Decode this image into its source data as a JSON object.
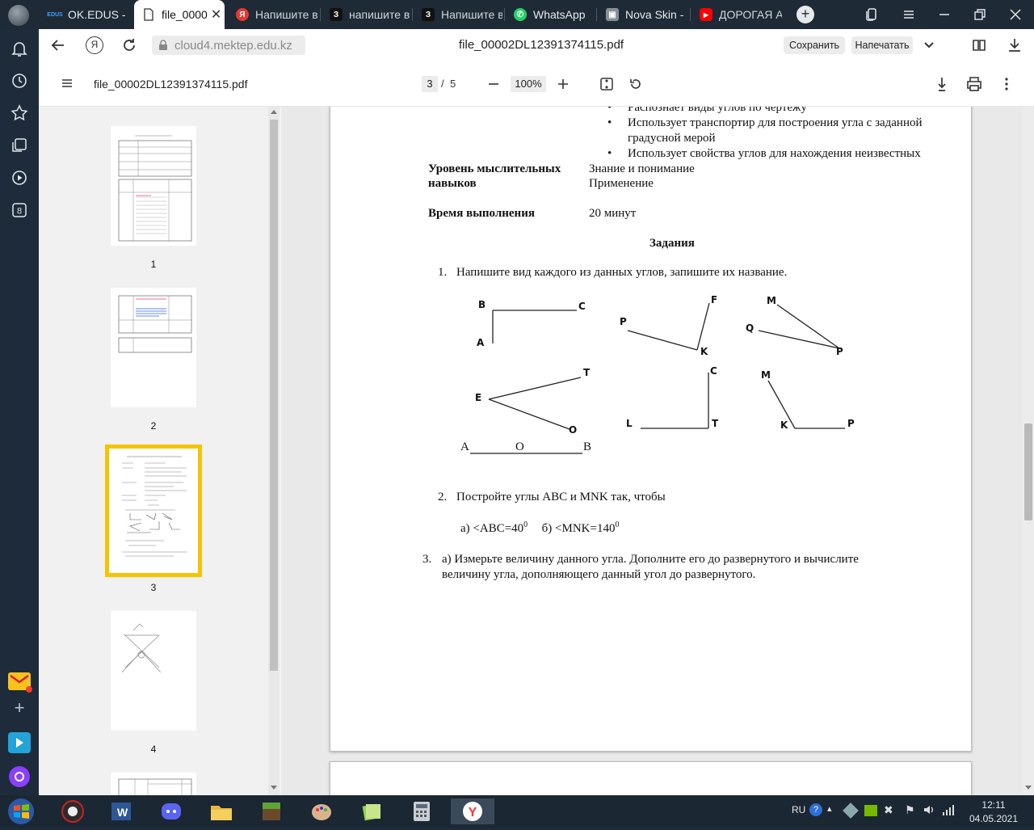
{
  "tabs": [
    {
      "label": "OK.EDUS -",
      "icon": "edus-icon"
    },
    {
      "label": "file_0000",
      "icon": "document-icon",
      "active": true
    },
    {
      "label": "Напишите в",
      "icon": "yandex-icon"
    },
    {
      "label": "напишите в",
      "icon": "znanija-icon"
    },
    {
      "label": "Напишите в",
      "icon": "znanija-icon"
    },
    {
      "label": "WhatsApp",
      "icon": "whatsapp-icon"
    },
    {
      "label": "Nova Skin -",
      "icon": "novaskin-icon"
    },
    {
      "label": "ДОРОГАЯ А",
      "icon": "youtube-icon"
    }
  ],
  "addressbar": {
    "url": "cloud4.mektep.edu.kz",
    "page_title": "file_00002DL12391374115.pdf",
    "save_label": "Сохранить",
    "print_label": "Напечатать"
  },
  "pdf_toolbar": {
    "filename": "file_00002DL12391374115.pdf",
    "current_page": "3",
    "separator": "/",
    "total_pages": "5",
    "zoom": "100%"
  },
  "thumbnails": [
    {
      "number": "1"
    },
    {
      "number": "2"
    },
    {
      "number": "3",
      "selected": true
    },
    {
      "number": "4"
    }
  ],
  "document": {
    "bullets": [
      "Распознает виды углов по чертежу",
      "Использует транспортир для построения угла с заданной",
      "градусной мерой",
      "Использует свойства углов для нахождения неизвестных"
    ],
    "level_label_1": "Уровень мыслительных",
    "level_label_2": "навыков",
    "level_value_1": "Знание и понимание",
    "level_value_2": "Применение",
    "time_label": "Время выполнения",
    "time_value": "20 минут",
    "tasks_heading": "Задания",
    "task1_num": "1.",
    "task1_text": "Напишите вид каждого из данных углов, запишите их название.",
    "task2_num": "2.",
    "task2_text": "Постройте углы АВС и MNK так, чтобы",
    "task2_a": "а)  <ABC=40",
    "task2_a_sup": "0",
    "task2_b": "б)  <MNK=140",
    "task2_b_sup": "0",
    "task3_num": "3.",
    "task3_line1": "а) Измерьте величину данного угла. Дополните его до развернутого и вычислите",
    "task3_line2": "величину угла, дополняющего данный угол до развернутого.",
    "figure_labels": {
      "B": "B",
      "C": "C",
      "A": "A",
      "P": "P",
      "F": "F",
      "K": "K",
      "M": "M",
      "Q": "Q",
      "P2": "P",
      "T": "T",
      "E": "E",
      "O": "O",
      "C2": "C",
      "L": "L",
      "T2": "T",
      "M2": "M",
      "K2": "K",
      "P3": "P",
      "A2": "А",
      "O2": "О",
      "B2": "В"
    }
  },
  "taskbar": {
    "lang": "RU",
    "time": "12:11",
    "date": "04.05.2021"
  },
  "colors": {
    "selected_thumb_border": "#f5c400",
    "tabbar_bg": "#1e2a36"
  }
}
